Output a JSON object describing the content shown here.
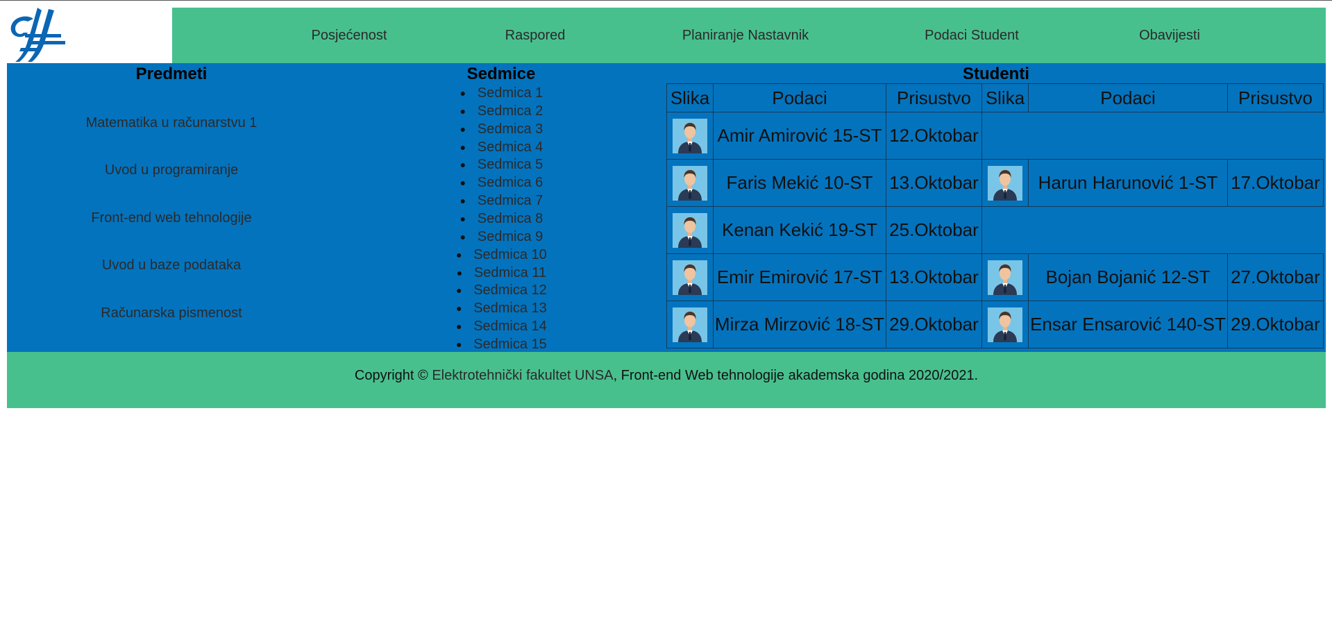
{
  "nav": {
    "items": [
      {
        "label": "Posjećenost"
      },
      {
        "label": "Raspored"
      },
      {
        "label": "Planiranje Nastavnik"
      },
      {
        "label": "Podaci Student"
      },
      {
        "label": "Obavijesti"
      }
    ]
  },
  "colors": {
    "nav_green": "#48c08e",
    "main_blue": "#0473bd"
  },
  "subjects": {
    "title": "Predmeti",
    "items": [
      "Matematika u računarstvu 1",
      "Uvod u programiranje",
      "Front-end web tehnologije",
      "Uvod u baze podataka",
      "Računarska pismenost"
    ]
  },
  "weeks": {
    "title": "Sedmice",
    "items": [
      "Sedmica 1",
      "Sedmica 2",
      "Sedmica 3",
      "Sedmica 4",
      "Sedmica 5",
      "Sedmica 6",
      "Sedmica 7",
      "Sedmica 8",
      "Sedmica 9",
      "Sedmica 10",
      "Sedmica 11",
      "Sedmica 12",
      "Sedmica 13",
      "Sedmica 14",
      "Sedmica 15"
    ]
  },
  "students": {
    "title": "Studenti",
    "headers": [
      "Slika",
      "Podaci",
      "Prisustvo",
      "Slika",
      "Podaci",
      "Prisustvo"
    ],
    "rows": [
      {
        "left": {
          "name": "Amir Amirović 15-ST",
          "date": "12.Oktobar"
        },
        "right": null
      },
      {
        "left": {
          "name": "Faris Mekić 10-ST",
          "date": "13.Oktobar"
        },
        "right": {
          "name": "Harun Harunović 1-ST",
          "date": "17.Oktobar"
        }
      },
      {
        "left": {
          "name": "Kenan Kekić 19-ST",
          "date": "25.Oktobar"
        },
        "right": null
      },
      {
        "left": {
          "name": "Emir Emirović 17-ST",
          "date": "13.Oktobar"
        },
        "right": {
          "name": "Bojan Bojanić 12-ST",
          "date": "27.Oktobar"
        }
      },
      {
        "left": {
          "name": "Mirza Mirzović 18-ST",
          "date": "29.Oktobar"
        },
        "right": {
          "name": "Ensar Ensarović 140-ST",
          "date": "29.Oktobar"
        }
      }
    ]
  },
  "footer": {
    "prefix": "Copyright © ",
    "link": "Elektrotehnički fakultet UNSA",
    "suffix": ", Front-end Web tehnologije akademska godina 2020/2021."
  }
}
